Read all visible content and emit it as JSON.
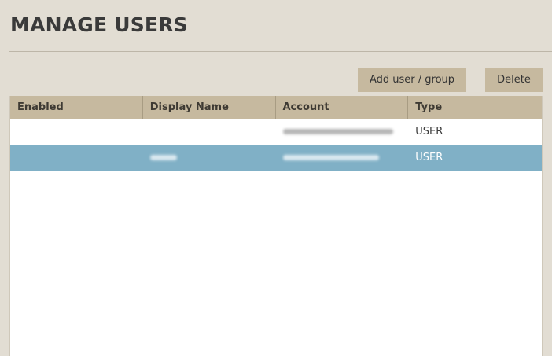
{
  "header": {
    "title": "MANAGE USERS"
  },
  "toolbar": {
    "add_label": "Add user / group",
    "delete_label": "Delete"
  },
  "table": {
    "columns": [
      "Enabled",
      "Display Name",
      "Account",
      "Type"
    ],
    "rows": [
      {
        "enabled": "",
        "display_name": "",
        "account": "",
        "type": "USER",
        "selected": false
      },
      {
        "enabled": "",
        "display_name": "",
        "account": "",
        "type": "USER",
        "selected": true
      }
    ]
  },
  "colors": {
    "background": "#e2ddd3",
    "accent": "#c6b99f",
    "selected_row": "#80b0c6"
  }
}
